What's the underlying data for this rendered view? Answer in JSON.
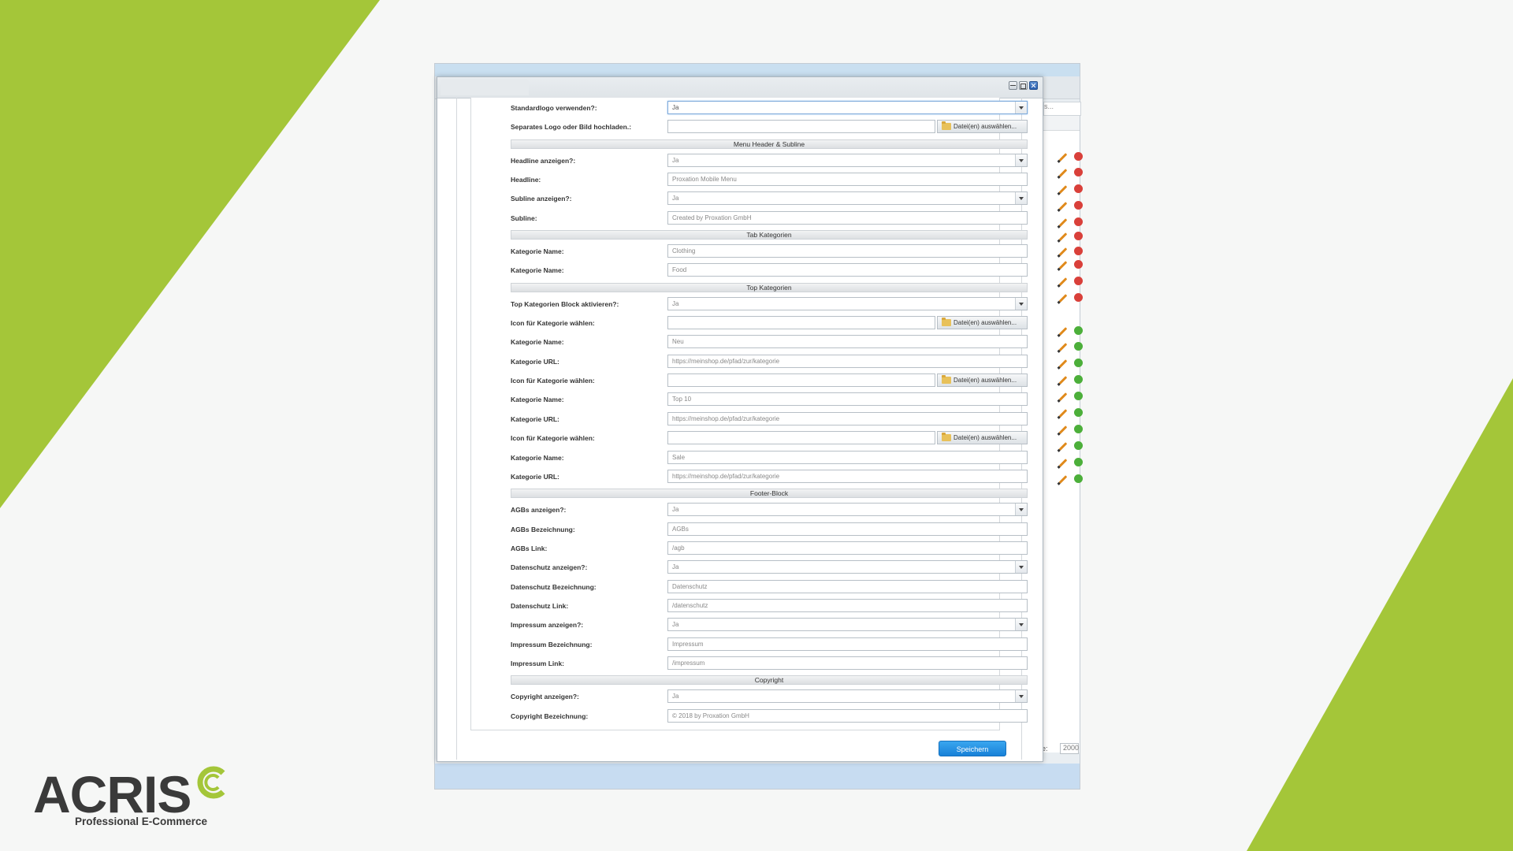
{
  "colors": {
    "brand_green": "#a4c639",
    "background": "#f6f7f6",
    "save_button": "#1f8fe3"
  },
  "brand": {
    "name": "ACRIS",
    "tagline": "Professional E-Commerce"
  },
  "backdrop": {
    "search_hint": "s...",
    "pagination_label": "e:",
    "pagination_value": "2000"
  },
  "form": {
    "rows": [
      {
        "type": "select",
        "label": "Standardlogo verwenden?:",
        "value": "Ja",
        "focused": true
      },
      {
        "type": "file",
        "label": "Separates Logo oder Bild hochladen.:",
        "value": "",
        "button": "Datei(en) auswählen..."
      },
      {
        "type": "section",
        "label": "Menu Header & Subline"
      },
      {
        "type": "select",
        "label": "Headline anzeigen?:",
        "value": "Ja"
      },
      {
        "type": "text",
        "label": "Headline:",
        "value": "Proxation Mobile Menu"
      },
      {
        "type": "select",
        "label": "Subline anzeigen?:",
        "value": "Ja"
      },
      {
        "type": "text",
        "label": "Subline:",
        "value": "Created by Proxation GmbH"
      },
      {
        "type": "section",
        "label": "Tab Kategorien"
      },
      {
        "type": "text",
        "label": "Kategorie Name:",
        "value": "Clothing"
      },
      {
        "type": "text",
        "label": "Kategorie Name:",
        "value": "Food"
      },
      {
        "type": "section",
        "label": "Top Kategorien"
      },
      {
        "type": "select",
        "label": "Top Kategorien Block aktivieren?:",
        "value": "Ja"
      },
      {
        "type": "file",
        "label": "Icon für Kategorie wählen:",
        "value": "",
        "button": "Datei(en) auswählen..."
      },
      {
        "type": "text",
        "label": "Kategorie Name:",
        "value": "Neu"
      },
      {
        "type": "text",
        "label": "Kategorie URL:",
        "value": "https://meinshop.de/pfad/zur/kategorie"
      },
      {
        "type": "file",
        "label": "Icon für Kategorie wählen:",
        "value": "",
        "button": "Datei(en) auswählen..."
      },
      {
        "type": "text",
        "label": "Kategorie Name:",
        "value": "Top 10"
      },
      {
        "type": "text",
        "label": "Kategorie URL:",
        "value": "https://meinshop.de/pfad/zur/kategorie"
      },
      {
        "type": "file",
        "label": "Icon für Kategorie wählen:",
        "value": "",
        "button": "Datei(en) auswählen..."
      },
      {
        "type": "text",
        "label": "Kategorie Name:",
        "value": "Sale"
      },
      {
        "type": "text",
        "label": "Kategorie URL:",
        "value": "https://meinshop.de/pfad/zur/kategorie"
      },
      {
        "type": "section",
        "label": "Footer-Block"
      },
      {
        "type": "select",
        "label": "AGBs anzeigen?:",
        "value": "Ja"
      },
      {
        "type": "text",
        "label": "AGBs Bezeichnung:",
        "value": "AGBs"
      },
      {
        "type": "text",
        "label": "AGBs Link:",
        "value": "/agb"
      },
      {
        "type": "select",
        "label": "Datenschutz anzeigen?:",
        "value": "Ja"
      },
      {
        "type": "text",
        "label": "Datenschutz Bezeichnung:",
        "value": "Datenschutz"
      },
      {
        "type": "text",
        "label": "Datenschutz Link:",
        "value": "/datenschutz"
      },
      {
        "type": "select",
        "label": "Impressum anzeigen?:",
        "value": "Ja"
      },
      {
        "type": "text",
        "label": "Impressum Bezeichnung:",
        "value": "Impressum"
      },
      {
        "type": "text",
        "label": "Impressum Link:",
        "value": "/impressum"
      },
      {
        "type": "section",
        "label": "Copyright"
      },
      {
        "type": "select",
        "label": "Copyright anzeigen?:",
        "value": "Ja"
      },
      {
        "type": "text",
        "label": "Copyright Bezeichnung:",
        "value": "© 2018 by Proxation GmbH"
      }
    ],
    "save_label": "Speichern"
  }
}
